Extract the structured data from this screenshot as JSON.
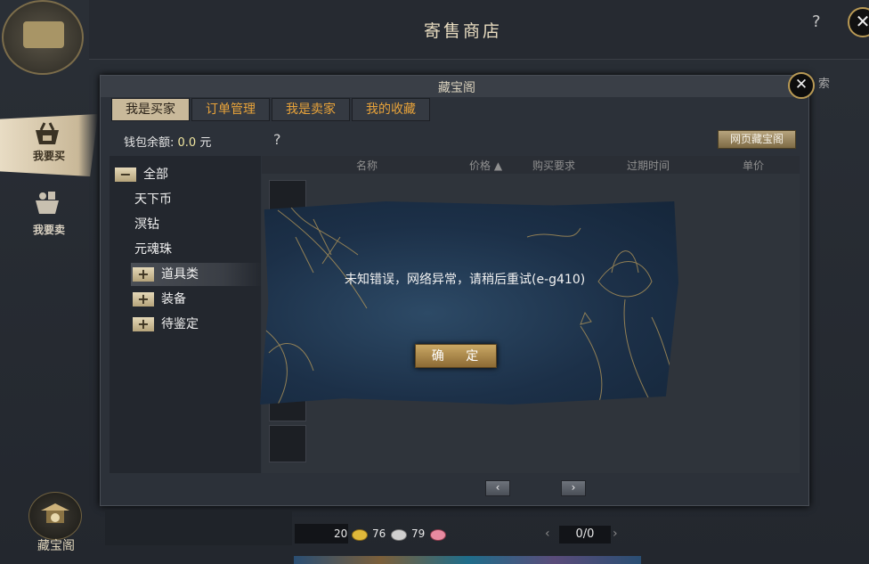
{
  "window": {
    "title": "寄售商店",
    "help": "?",
    "close": "✕"
  },
  "side_tabs": [
    {
      "label": "我要买"
    },
    {
      "label": "我要卖"
    }
  ],
  "treasure": {
    "label": "藏宝阁"
  },
  "panel": {
    "title": "藏宝阁",
    "close": "✕",
    "search_fragment": "索",
    "tabs": [
      "我是买家",
      "订单管理",
      "我是卖家",
      "我的收藏"
    ],
    "wallet_label": "钱包余额:",
    "wallet_value": "0.0",
    "wallet_unit": "元",
    "help": "?",
    "web_button": "网页藏宝阁"
  },
  "tree": {
    "items": [
      {
        "label": "全部",
        "toggle": "−"
      },
      {
        "label": "天下币"
      },
      {
        "label": "溟钻"
      },
      {
        "label": "元魂珠"
      },
      {
        "label": "道具类",
        "toggle": "+"
      },
      {
        "label": "装备",
        "toggle": "+"
      },
      {
        "label": "待鉴定",
        "toggle": "+"
      }
    ]
  },
  "list": {
    "columns": [
      "名称",
      "价格 ▲",
      "购买要求",
      "过期时间",
      "单价"
    ]
  },
  "pager": {
    "prev": "‹",
    "next": "›"
  },
  "bottom": {
    "gold": "20",
    "silver": "76",
    "copper": "79",
    "page": "0/0",
    "page_prev": "‹",
    "page_next": "›",
    "colors": {
      "gold_coin": "#e0b83a",
      "silver_coin": "#d0d0d0",
      "copper_coin": "#e88aa0"
    }
  },
  "dialog": {
    "message": "未知错误，网络异常，请稍后重试(e-g410)",
    "ok": "确 定"
  }
}
